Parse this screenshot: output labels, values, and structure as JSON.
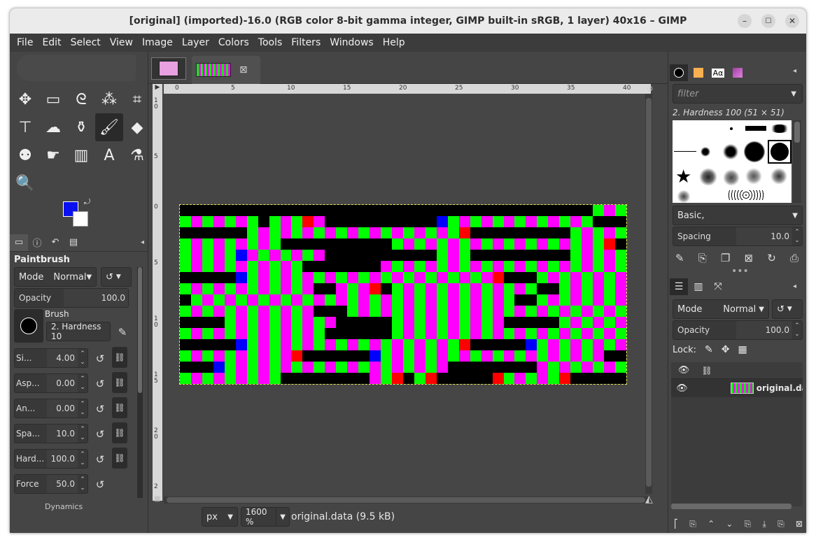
{
  "window": {
    "title": "[original] (imported)-16.0 (RGB color 8-bit gamma integer, GIMP built-in sRGB, 1 layer) 40x16 – GIMP",
    "minimize": "–",
    "maximize": "☐",
    "close": "✕"
  },
  "menu": [
    "File",
    "Edit",
    "Select",
    "View",
    "Image",
    "Layer",
    "Colors",
    "Tools",
    "Filters",
    "Windows",
    "Help"
  ],
  "toolbox": {
    "icons": [
      "move-icon",
      "rect-select-icon",
      "lasso-icon",
      "fuzzy-select-icon",
      "crop-icon",
      "unified-transform-icon",
      "warp-icon",
      "bucket-fill-icon",
      "paintbrush-icon",
      "eraser-icon",
      "clone-icon",
      "smudge-icon",
      "gradient-icon",
      "text-icon",
      "color-picker-icon",
      "zoom-icon"
    ],
    "glyphs": [
      "✥",
      "▭",
      "ᘓ",
      "⁂",
      "⌗",
      "⊤",
      "☁",
      "⚱",
      "🖌",
      "◆",
      "⚉",
      "☛",
      "▥",
      "A",
      "⚗",
      "🔍"
    ],
    "foreground_color": "#0a10f0",
    "background_color": "#ffffff"
  },
  "tool_options": {
    "title": "Paintbrush",
    "mode_label": "Mode",
    "mode_value": "Normal",
    "opacity_label": "Opacity",
    "opacity_value": "100.0",
    "brush_label": "Brush",
    "brush_value": "2. Hardness 10",
    "size_label": "Si...",
    "size_value": "4.00",
    "aspect_label": "Asp...",
    "aspect_value": "0.00",
    "angle_label": "An...",
    "angle_value": "0.00",
    "spacing_label": "Spa...",
    "spacing_value": "10.0",
    "hardness_label": "Hard...",
    "hardness_value": "100.0",
    "force_label": "Force",
    "force_value": "50.0",
    "dynamics_label": "Dynamics"
  },
  "canvas": {
    "ruler_top": [
      "0",
      "5",
      "10",
      "15",
      "20",
      "25",
      "30",
      "35",
      "40"
    ],
    "ruler_left": [
      "1\n0",
      "5",
      "0",
      "5",
      "1\n0",
      "1\n5",
      "2\n0",
      "2"
    ],
    "width": 40,
    "height": 16,
    "palette": {
      "k": "#000000",
      "g": "#00ff00",
      "m": "#ff00ff",
      "r": "#ff0000",
      "b": "#0000ff"
    },
    "rows": [
      "kkkkkkkkkkkkkkkkkkkkkkkkkkkkkkkkkkkkkgmgmg",
      "gmgmgmgkgmgrmkkkkkkkkkkbgmgmgmgmgmgmgkkkk",
      "kkkkkkgmgmgmgmgmgmgmgmgmgrkkkkkkkkkgmgmgm",
      "gmgmgmgmgkkkkkkkkkkgmgmgmgmgmgmgmgmgmgrkk",
      "gmgmgbmgmgmgmkkkkkkkkkkgmgkkkkkkkkkgmgmgm",
      "gmgmgmgmgmgkkkkkkkmgmgmgmgmgmgmgmgmgmgmgk",
      "kkkkkbgmgmgmgmgmgmgmgmgmgmgmrkkkgmgmgmgmk",
      "gmgmgmgmgmgmkkmgmrkgmgmgmgmgmgmgkkgmgmgmk",
      "kgmgmgmgmgmgmgmgmgmgmgmgmgmgmgkkgmgmgmgmr",
      "gmgmgmgmgmgmkkkgmgmgmgmgmgmgmgmgmgmgmgmgm",
      "kkkkgmgmgmgmgmkkkkkgmgmgmgmgmkkkkkgmgmgmm",
      "gmgmgmgmgmgmgkkkkkkgmgmgmgmgmgmgmgmgmgmgr",
      "kkkkkbgmgmgmgmgmgmgmgmgmgrkkkkkbgmgmgmgmm",
      "gmgmgmgmgmrkkkkkkbgmgmgmgmgmgmgmgmgmgmkkk",
      "kkkbgmgmgmgmgmgmgmgmgmgmkkkkkkkkmgmgmgmgm",
      "gmgmgmgmgkkkkkkkkmgrkgrkkkkkrgmgmgrkkkkkk"
    ]
  },
  "status": {
    "unit": "px",
    "zoom": "1600 %",
    "file": "original.data (9.5 kB)"
  },
  "brushes_panel": {
    "filter_placeholder": "filter",
    "selected_brush": "2. Hardness 100 (51 × 51)",
    "preset": "Basic,",
    "spacing_label": "Spacing",
    "spacing_value": "10.0"
  },
  "layers_panel": {
    "mode_label": "Mode",
    "mode_value": "Normal",
    "opacity_label": "Opacity",
    "opacity_value": "100.0",
    "lock_label": "Lock:",
    "layer_name": "original.da"
  }
}
